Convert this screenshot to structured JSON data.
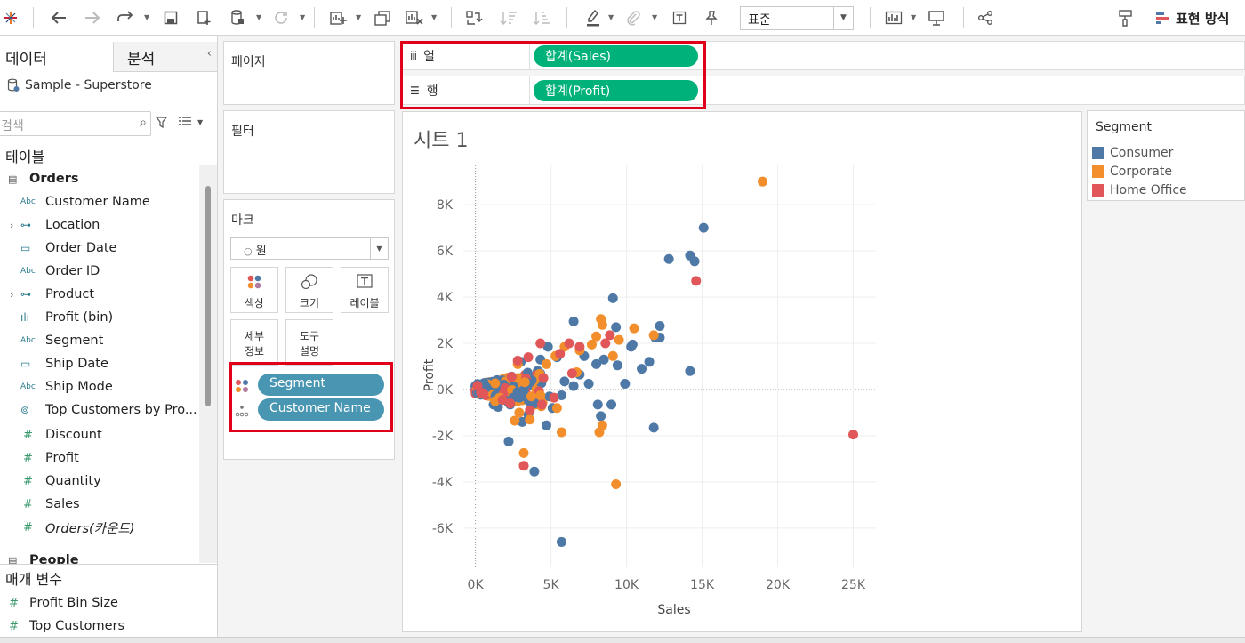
{
  "toolbar": {
    "style_select": "표준",
    "show_me_label": "표현 방식"
  },
  "data_pane": {
    "tab_data": "데이터",
    "tab_analysis": "분석",
    "datasource": "Sample - Superstore",
    "search_placeholder": "검색",
    "tables_header": "테이블",
    "params_header": "매개 변수",
    "tables": [
      {
        "name": "Orders",
        "type": "table"
      },
      {
        "name": "People",
        "type": "table"
      }
    ],
    "fields": [
      {
        "name": "Customer Name",
        "icon": "Abc",
        "expand": false
      },
      {
        "name": "Location",
        "icon": "hierarchy",
        "expand": true
      },
      {
        "name": "Order Date",
        "icon": "calendar",
        "expand": false
      },
      {
        "name": "Order ID",
        "icon": "Abc",
        "expand": false
      },
      {
        "name": "Product",
        "icon": "hierarchy",
        "expand": true
      },
      {
        "name": "Profit (bin)",
        "icon": "bin",
        "expand": false
      },
      {
        "name": "Segment",
        "icon": "Abc",
        "expand": false
      },
      {
        "name": "Ship Date",
        "icon": "calendar",
        "expand": false
      },
      {
        "name": "Ship Mode",
        "icon": "Abc",
        "expand": false
      },
      {
        "name": "Top Customers by Pro...",
        "icon": "set",
        "expand": false
      }
    ],
    "measures": [
      {
        "name": "Discount",
        "icon": "#"
      },
      {
        "name": "Profit",
        "icon": "#"
      },
      {
        "name": "Quantity",
        "icon": "#"
      },
      {
        "name": "Sales",
        "icon": "#"
      },
      {
        "name": "Orders(카운트)",
        "icon": "#",
        "italic": true
      }
    ],
    "parameters": [
      {
        "name": "Profit Bin Size"
      },
      {
        "name": "Top Customers"
      }
    ]
  },
  "cards": {
    "pages_title": "페이지",
    "filters_title": "필터",
    "marks_title": "마크",
    "mark_type": "원",
    "mark_buttons": {
      "color": "색상",
      "size": "크기",
      "label": "레이블",
      "detail_line1": "세부",
      "detail_line2": "정보",
      "tooltip_line1": "도구",
      "tooltip_line2": "설명"
    },
    "mark_pills": [
      {
        "name": "Segment",
        "encoding": "color"
      },
      {
        "name": "Customer Name",
        "encoding": "detail"
      }
    ]
  },
  "shelves": {
    "columns_label": "열",
    "rows_label": "행",
    "columns_pill": "합계(Sales)",
    "rows_pill": "합계(Profit)"
  },
  "sheet": {
    "title": "시트 1"
  },
  "legend": {
    "title": "Segment",
    "items": [
      {
        "name": "Consumer",
        "color": "#4e79a7"
      },
      {
        "name": "Corporate",
        "color": "#f28e2b"
      },
      {
        "name": "Home Office",
        "color": "#e15759"
      }
    ]
  },
  "colors": {
    "consumer": "#4e79a7",
    "corporate": "#f28e2b",
    "home_office": "#e15759",
    "measure_pill": "#00b17a",
    "dimension_pill": "#4996b2",
    "highlight": "#e0001a"
  },
  "chart_data": {
    "type": "scatter",
    "xlabel": "Sales",
    "ylabel": "Profit",
    "xlim": [
      -800,
      26500
    ],
    "ylim": [
      -7700,
      9700
    ],
    "x_ticks": [
      "0K",
      "5K",
      "10K",
      "15K",
      "20K",
      "25K"
    ],
    "y_ticks": [
      "8K",
      "6K",
      "4K",
      "2K",
      "0K",
      "-2K",
      "-4K",
      "-6K"
    ],
    "grid": true,
    "legend": "right",
    "series": [
      {
        "name": "Consumer",
        "points": [
          [
            15100,
            7000
          ],
          [
            12800,
            5650
          ],
          [
            14200,
            5800
          ],
          [
            14500,
            5550
          ],
          [
            9100,
            3950
          ],
          [
            6500,
            2950
          ],
          [
            12200,
            2750
          ],
          [
            9300,
            2700
          ],
          [
            11900,
            2250
          ],
          [
            12200,
            2250
          ],
          [
            10400,
            1950
          ],
          [
            11500,
            1200
          ],
          [
            11000,
            900
          ],
          [
            10300,
            1850
          ],
          [
            7200,
            1450
          ],
          [
            8500,
            1300
          ],
          [
            8000,
            1100
          ],
          [
            9400,
            1050
          ],
          [
            14200,
            800
          ],
          [
            9900,
            250
          ],
          [
            7500,
            250
          ],
          [
            6900,
            650
          ],
          [
            5900,
            350
          ],
          [
            6500,
            150
          ],
          [
            5700,
            -250
          ],
          [
            4900,
            -300
          ],
          [
            5100,
            -800
          ],
          [
            3900,
            -600
          ],
          [
            3500,
            -1100
          ],
          [
            3100,
            -1400
          ],
          [
            4700,
            -1550
          ],
          [
            8100,
            -650
          ],
          [
            8300,
            -1150
          ],
          [
            9000,
            -650
          ],
          [
            11800,
            -1650
          ],
          [
            2200,
            -2250
          ],
          [
            3900,
            -3550
          ],
          [
            5700,
            -6600
          ],
          [
            3300,
            -300
          ],
          [
            2800,
            -100
          ],
          [
            1500,
            -750
          ],
          [
            1200,
            -650
          ],
          [
            2100,
            -500
          ],
          [
            2500,
            -350
          ],
          [
            2300,
            -650
          ],
          [
            4300,
            1300
          ],
          [
            4800,
            1850
          ],
          [
            3000,
            1200
          ],
          [
            5400,
            1400
          ]
        ]
      },
      {
        "name": "Corporate",
        "points": [
          [
            19000,
            9000
          ],
          [
            8300,
            3050
          ],
          [
            8400,
            2800
          ],
          [
            9500,
            2150
          ],
          [
            10500,
            2650
          ],
          [
            11800,
            2350
          ],
          [
            8000,
            2300
          ],
          [
            7700,
            1950
          ],
          [
            5900,
            1850
          ],
          [
            5300,
            1450
          ],
          [
            6900,
            1700
          ],
          [
            9100,
            1450
          ],
          [
            4700,
            1100
          ],
          [
            6700,
            750
          ],
          [
            5400,
            -800
          ],
          [
            3600,
            -1300
          ],
          [
            3200,
            -2750
          ],
          [
            5700,
            -1850
          ],
          [
            8200,
            -1850
          ],
          [
            8400,
            -1550
          ],
          [
            9300,
            -4100
          ],
          [
            2800,
            1100
          ],
          [
            3700,
            -300
          ],
          [
            4300,
            -250
          ],
          [
            1300,
            -500
          ],
          [
            1600,
            -350
          ],
          [
            2600,
            -1350
          ],
          [
            2900,
            -1000
          ]
        ]
      },
      {
        "name": "Home Office",
        "points": [
          [
            14600,
            4700
          ],
          [
            25000,
            -1950
          ],
          [
            4300,
            2000
          ],
          [
            6900,
            1850
          ],
          [
            6200,
            2000
          ],
          [
            8600,
            2000
          ],
          [
            8900,
            2350
          ],
          [
            5600,
            1550
          ],
          [
            6400,
            700
          ],
          [
            4500,
            500
          ],
          [
            3200,
            -3300
          ],
          [
            2300,
            -600
          ],
          [
            3600,
            -900
          ],
          [
            4400,
            -650
          ],
          [
            5200,
            -350
          ],
          [
            1800,
            -450
          ],
          [
            2800,
            1250
          ],
          [
            3500,
            1400
          ]
        ]
      }
    ]
  }
}
